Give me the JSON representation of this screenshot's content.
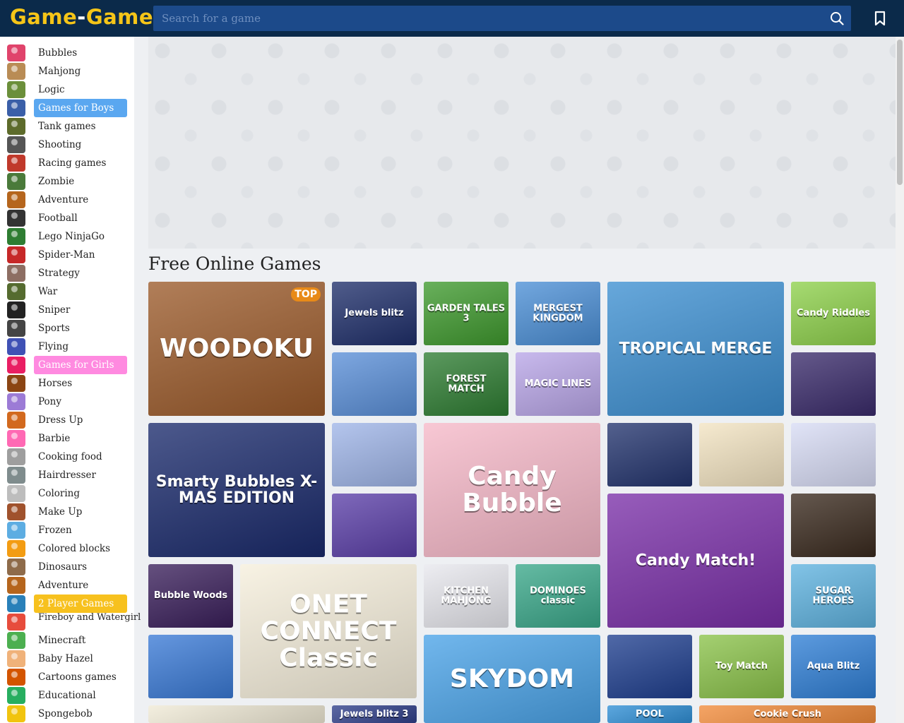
{
  "header": {
    "logo_part1": "Game",
    "logo_sep": "-",
    "logo_part2": "Game",
    "search_placeholder": "Search for a game",
    "icons": [
      "search-icon",
      "bookmark-icon"
    ]
  },
  "sidebar": {
    "items": [
      {
        "label": "Bubbles",
        "color": "#e0436b"
      },
      {
        "label": "Mahjong",
        "color": "#b98c55"
      },
      {
        "label": "Logic",
        "color": "#6b8f3a"
      },
      {
        "label": "Games for Boys",
        "color": "#3a5fa8"
      },
      {
        "label": "Tank games",
        "color": "#5d6b2b"
      },
      {
        "label": "Shooting",
        "color": "#555555"
      },
      {
        "label": "Racing games",
        "color": "#c0392b"
      },
      {
        "label": "Zombie",
        "color": "#4a7a3a"
      },
      {
        "label": "Adventure",
        "color": "#b5651d"
      },
      {
        "label": "Football",
        "color": "#333333"
      },
      {
        "label": "Lego NinjaGo",
        "color": "#2e7d32"
      },
      {
        "label": "Spider-Man",
        "color": "#c62828"
      },
      {
        "label": "Strategy",
        "color": "#8d6e63"
      },
      {
        "label": "War",
        "color": "#556b2f"
      },
      {
        "label": "Sniper",
        "color": "#222222"
      },
      {
        "label": "Sports",
        "color": "#444444"
      },
      {
        "label": "Flying",
        "color": "#3f51b5"
      },
      {
        "label": "Games for Girls",
        "color": "#e91e63"
      },
      {
        "label": "Horses",
        "color": "#8b4513"
      },
      {
        "label": "Pony",
        "color": "#9c7bd6"
      },
      {
        "label": "Dress Up",
        "color": "#d2691e"
      },
      {
        "label": "Barbie",
        "color": "#ff69b4"
      },
      {
        "label": "Cooking food",
        "color": "#9e9e9e"
      },
      {
        "label": "Hairdresser",
        "color": "#7f8c8d"
      },
      {
        "label": "Coloring",
        "color": "#bdbdbd"
      },
      {
        "label": "Make Up",
        "color": "#a0522d"
      },
      {
        "label": "Frozen",
        "color": "#5dade2"
      },
      {
        "label": "Colored blocks",
        "color": "#f39c12"
      },
      {
        "label": "Dinosaurs",
        "color": "#8e6b4a"
      },
      {
        "label": "Adventure",
        "color": "#b5651d"
      },
      {
        "label": "2 Player Games",
        "color": "#2980b9"
      },
      {
        "label": "Fireboy and Watergirl",
        "color": "#e74c3c"
      },
      {
        "label": "Minecraft",
        "color": "#4caf50"
      },
      {
        "label": "Baby Hazel",
        "color": "#f0b27a"
      },
      {
        "label": "Cartoons games",
        "color": "#d35400"
      },
      {
        "label": "Educational",
        "color": "#27ae60"
      },
      {
        "label": "Spongebob",
        "color": "#f1c40f"
      }
    ]
  },
  "main": {
    "section_title": "Free Online Games",
    "top_badge": "TOP",
    "tiles": [
      {
        "title": "WOODOKU",
        "bg": "#9b5a2a"
      },
      {
        "title": "Jewels blitz",
        "bg": "#1f2f6b"
      },
      {
        "title": "GARDEN TALES 3",
        "bg": "#3f9a2e"
      },
      {
        "title": "MERGEST KINGDOM",
        "bg": "#4b8fd6"
      },
      {
        "title": "TROPICAL MERGE",
        "bg": "#3c8fd1"
      },
      {
        "title": "Candy Riddles",
        "bg": "#8ed14b"
      },
      {
        "title": "",
        "bg": "#5a8fd8"
      },
      {
        "title": "FOREST MATCH",
        "bg": "#2e7d32"
      },
      {
        "title": "MAGIC LINES",
        "bg": "#b9a6e8"
      },
      {
        "title": "",
        "bg": "#3a2b6b"
      },
      {
        "title": "Smarty Bubbles X-MAS EDITION",
        "bg": "#1a2a6c"
      },
      {
        "title": "",
        "bg": "#9fb5e8"
      },
      {
        "title": "Candy Bubble",
        "bg": "#f6b8c8"
      },
      {
        "title": "",
        "bg": "#23346e"
      },
      {
        "title": "",
        "bg": "#f3e4c2"
      },
      {
        "title": "",
        "bg": "#d8dcf5"
      },
      {
        "title": "",
        "bg": "#5b3fa8"
      },
      {
        "title": "Candy Match!",
        "bg": "#7a2fa8"
      },
      {
        "title": "",
        "bg": "#3a2a1e"
      },
      {
        "title": "Bubble Woods",
        "bg": "#3a1f5b"
      },
      {
        "title": "ONET CONNECT Classic",
        "bg": "#f6efdc"
      },
      {
        "title": "KITCHEN MAHJONG",
        "bg": "#e8e8ee"
      },
      {
        "title": "DOMINOES classic",
        "bg": "#3aa88a"
      },
      {
        "title": "SUGAR HEROES",
        "bg": "#5fb3e0"
      },
      {
        "title": "",
        "bg": "#3a7ad6"
      },
      {
        "title": "SKYDOM",
        "bg": "#4aa3e8"
      },
      {
        "title": "",
        "bg": "#1f3f8f"
      },
      {
        "title": "Toy Match",
        "bg": "#8bc34a"
      },
      {
        "title": "Aqua Blitz",
        "bg": "#2f7fd6"
      },
      {
        "title": "",
        "bg": "#f0ead6"
      },
      {
        "title": "Jewels blitz 3",
        "bg": "#2f3f8a"
      },
      {
        "title": "POOL",
        "bg": "#2f8fd6"
      },
      {
        "title": "Cookie Crush",
        "bg": "#f28b3a"
      }
    ]
  },
  "scrollbar": {
    "position": 0.0
  }
}
